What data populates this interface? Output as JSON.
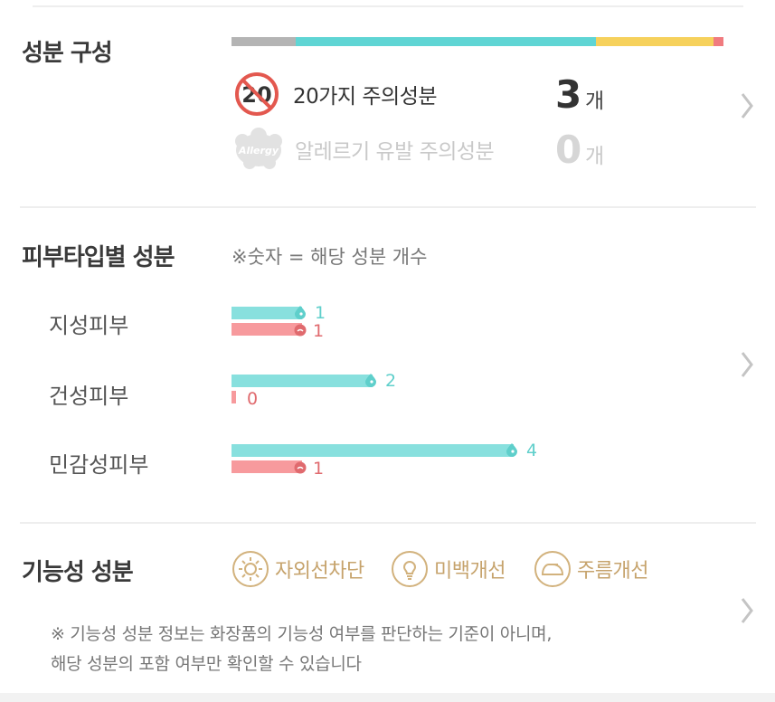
{
  "composition": {
    "title": "성분 구성",
    "segments": [
      {
        "name": "gray",
        "share": 0.13,
        "color": "#b4b4b4"
      },
      {
        "name": "teal",
        "share": 0.61,
        "color": "#5fd5d4"
      },
      {
        "name": "yellow",
        "share": 0.24,
        "color": "#f6d15c"
      },
      {
        "name": "red",
        "share": 0.02,
        "color": "#f07b7f"
      }
    ],
    "caution20": {
      "icon_text": "20",
      "label": "20가지 주의성분",
      "count": "3",
      "unit": "개"
    },
    "allergy": {
      "icon_text": "Allergy",
      "label": "알레르기 유발 주의성분",
      "count": "0",
      "unit": "개"
    }
  },
  "skin_type": {
    "title": "피부타입별 성분",
    "note": "※숫자 = 해당 성분 개수",
    "max_value": 4,
    "rows": [
      {
        "label": "지성피부",
        "good": 1,
        "good_text": "1",
        "bad": 1,
        "bad_text": "1"
      },
      {
        "label": "건성피부",
        "good": 2,
        "good_text": "2",
        "bad": 0,
        "bad_text": "0"
      },
      {
        "label": "민감성피부",
        "good": 4,
        "good_text": "4",
        "bad": 1,
        "bad_text": "1"
      }
    ],
    "colors": {
      "good": "#88e0de",
      "bad": "#f79a9d"
    }
  },
  "functional": {
    "title": "기능성 성분",
    "chips": [
      {
        "icon": "sun-icon",
        "label": "자외선차단"
      },
      {
        "icon": "lightbulb-icon",
        "label": "미백개선"
      },
      {
        "icon": "iron-icon",
        "label": "주름개선"
      }
    ],
    "note_line1": "※ 기능성 성분 정보는 화장품의 기능성 여부를 판단하는 기준이 아니며,",
    "note_line2": "해당 성분의 포함 여부만 확인할 수 있습니다"
  }
}
